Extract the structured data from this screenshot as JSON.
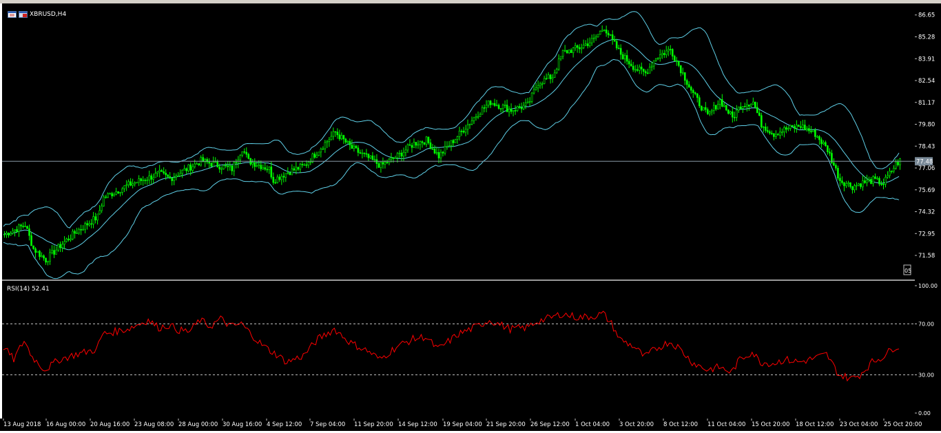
{
  "window": {
    "symbol_title": "XBRUSD,H4"
  },
  "price_pane": {
    "y_min": 70.2,
    "y_max": 87.2,
    "y_ticks": [
      "86.65",
      "85.28",
      "83.91",
      "82.54",
      "81.17",
      "79.80",
      "78.43",
      "77.06",
      "75.69",
      "74.32",
      "72.95",
      "71.58"
    ],
    "current_price": "77.48",
    "grid": false,
    "candle_color": "#00ff00",
    "band_color": "#5fd0e8",
    "hline_color": "#8a9aa8",
    "price_line_value": 77.48,
    "scroll_label": "05"
  },
  "rsi_pane": {
    "title": "RSI(14) 52.41",
    "y_ticks": [
      "100.00",
      "70.00",
      "30.00",
      "0.00"
    ],
    "levels": [
      70,
      30
    ],
    "line_color": "#ff0000"
  },
  "x_ticks": [
    "13 Aug 2018",
    "16 Aug 00:00",
    "20 Aug 16:00",
    "23 Aug 08:00",
    "28 Aug 00:00",
    "30 Aug 16:00",
    "4 Sep 12:00",
    "7 Sep 04:00",
    "11 Sep 20:00",
    "14 Sep 12:00",
    "19 Sep 04:00",
    "21 Sep 20:00",
    "26 Sep 12:00",
    "1 Oct 04:00",
    "3 Oct 20:00",
    "8 Oct 12:00",
    "11 Oct 04:00",
    "15 Oct 20:00",
    "18 Oct 12:00",
    "23 Oct 04:00",
    "25 Oct 20:00"
  ],
  "chart_data": {
    "type": "line",
    "price_anchors": [
      [
        0,
        72.9
      ],
      [
        5,
        73.2
      ],
      [
        10,
        73.5
      ],
      [
        14,
        72.0
      ],
      [
        20,
        71.3
      ],
      [
        27,
        72.2
      ],
      [
        35,
        73.1
      ],
      [
        45,
        74.0
      ],
      [
        48,
        75.2
      ],
      [
        60,
        76.0
      ],
      [
        75,
        76.7
      ],
      [
        80,
        76.4
      ],
      [
        95,
        77.5
      ],
      [
        110,
        77.0
      ],
      [
        115,
        78.3
      ],
      [
        118,
        77.5
      ],
      [
        128,
        77.0
      ],
      [
        130,
        76.3
      ],
      [
        137,
        76.8
      ],
      [
        145,
        77.2
      ],
      [
        152,
        78.2
      ],
      [
        160,
        79.3
      ],
      [
        168,
        78.3
      ],
      [
        177,
        77.6
      ],
      [
        182,
        77.2
      ],
      [
        190,
        77.8
      ],
      [
        198,
        78.6
      ],
      [
        204,
        78.8
      ],
      [
        210,
        77.8
      ],
      [
        220,
        79.2
      ],
      [
        229,
        80.5
      ],
      [
        235,
        81.2
      ],
      [
        245,
        80.7
      ],
      [
        253,
        81.0
      ],
      [
        258,
        82.4
      ],
      [
        265,
        82.8
      ],
      [
        270,
        84.3
      ],
      [
        278,
        84.6
      ],
      [
        285,
        85.1
      ],
      [
        290,
        85.9
      ],
      [
        294,
        85.0
      ],
      [
        298,
        84.2
      ],
      [
        305,
        83.3
      ],
      [
        310,
        83.0
      ],
      [
        315,
        84.0
      ],
      [
        322,
        84.5
      ],
      [
        326,
        83.5
      ],
      [
        333,
        81.7
      ],
      [
        340,
        80.3
      ],
      [
        346,
        81.3
      ],
      [
        352,
        80.2
      ],
      [
        356,
        81.0
      ],
      [
        362,
        81.2
      ],
      [
        366,
        79.8
      ],
      [
        372,
        79.2
      ],
      [
        378,
        79.5
      ],
      [
        385,
        79.7
      ],
      [
        392,
        79.2
      ],
      [
        398,
        78.2
      ],
      [
        404,
        76.3
      ],
      [
        410,
        75.9
      ],
      [
        414,
        76.1
      ],
      [
        420,
        76.3
      ],
      [
        425,
        76.1
      ],
      [
        431,
        77.3
      ],
      [
        433,
        77.5
      ]
    ],
    "rsi_anchors": [
      [
        0,
        52
      ],
      [
        5,
        42
      ],
      [
        10,
        57
      ],
      [
        14,
        44
      ],
      [
        20,
        34
      ],
      [
        27,
        42
      ],
      [
        35,
        46
      ],
      [
        45,
        50
      ],
      [
        48,
        62
      ],
      [
        60,
        66
      ],
      [
        70,
        73
      ],
      [
        75,
        67
      ],
      [
        80,
        69
      ],
      [
        85,
        65
      ],
      [
        90,
        64
      ],
      [
        95,
        73
      ],
      [
        100,
        68
      ],
      [
        105,
        74
      ],
      [
        110,
        68
      ],
      [
        115,
        70
      ],
      [
        118,
        65
      ],
      [
        124,
        55
      ],
      [
        128,
        50
      ],
      [
        132,
        46
      ],
      [
        137,
        40
      ],
      [
        145,
        45
      ],
      [
        152,
        58
      ],
      [
        160,
        66
      ],
      [
        168,
        55
      ],
      [
        177,
        48
      ],
      [
        182,
        42
      ],
      [
        190,
        52
      ],
      [
        198,
        58
      ],
      [
        204,
        60
      ],
      [
        210,
        50
      ],
      [
        220,
        62
      ],
      [
        229,
        68
      ],
      [
        235,
        73
      ],
      [
        245,
        66
      ],
      [
        253,
        67
      ],
      [
        258,
        72
      ],
      [
        265,
        75
      ],
      [
        270,
        78
      ],
      [
        278,
        75
      ],
      [
        285,
        76
      ],
      [
        290,
        78
      ],
      [
        294,
        70
      ],
      [
        298,
        58
      ],
      [
        305,
        52
      ],
      [
        310,
        44
      ],
      [
        315,
        50
      ],
      [
        322,
        56
      ],
      [
        326,
        52
      ],
      [
        333,
        40
      ],
      [
        340,
        34
      ],
      [
        346,
        36
      ],
      [
        352,
        32
      ],
      [
        356,
        42
      ],
      [
        362,
        48
      ],
      [
        366,
        40
      ],
      [
        372,
        39
      ],
      [
        378,
        42
      ],
      [
        385,
        40
      ],
      [
        392,
        43
      ],
      [
        398,
        46
      ],
      [
        404,
        30
      ],
      [
        410,
        27
      ],
      [
        414,
        30
      ],
      [
        420,
        40
      ],
      [
        425,
        44
      ],
      [
        431,
        52
      ],
      [
        433,
        52.41
      ]
    ]
  }
}
